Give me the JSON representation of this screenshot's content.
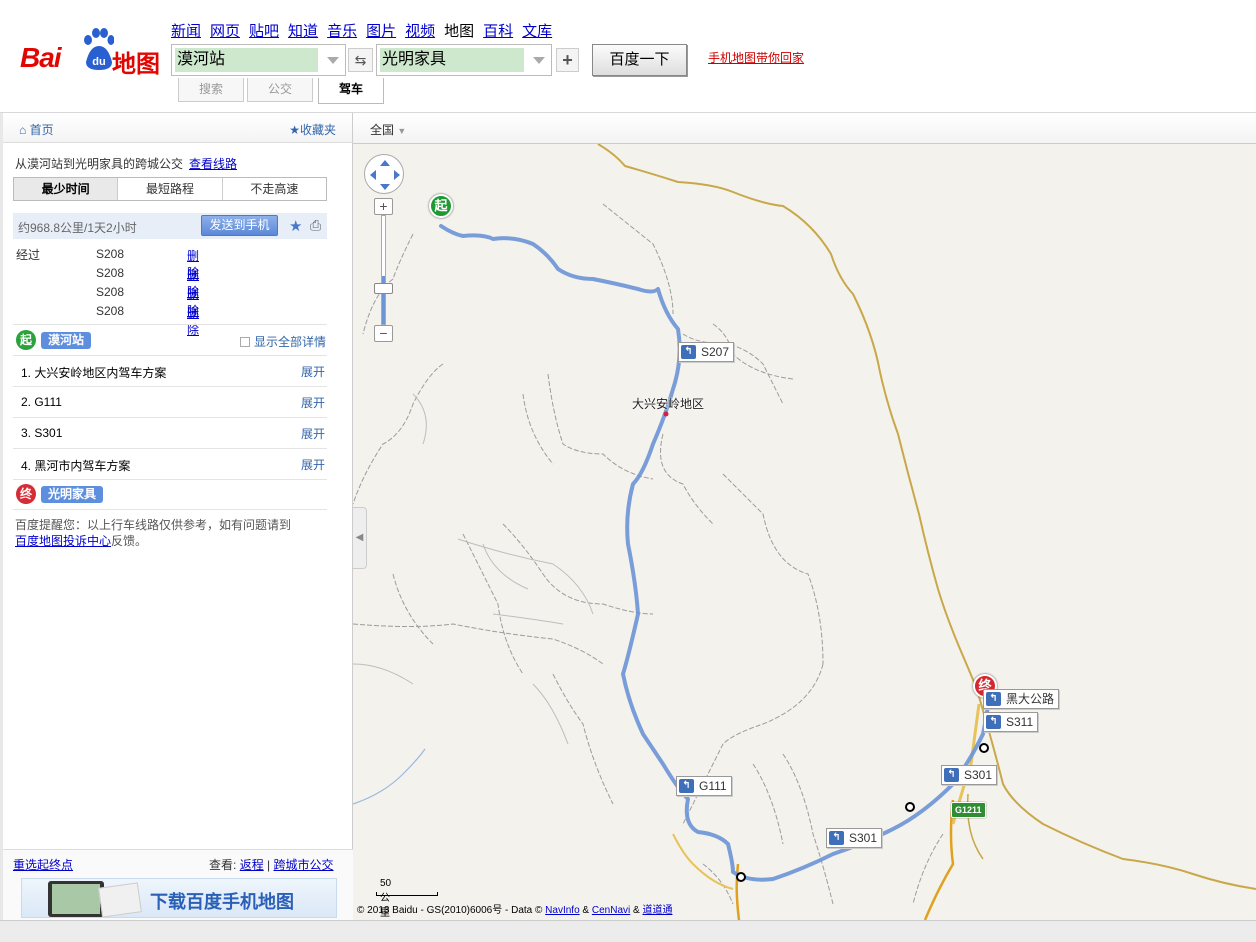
{
  "brand": {
    "logo_text_left": "Bai",
    "logo_text_mid": "du",
    "logo_text_right": "地图"
  },
  "nav": [
    "新闻",
    "网页",
    "贴吧",
    "知道",
    "音乐",
    "图片",
    "视频",
    "地图",
    "百科",
    "文库"
  ],
  "nav_current": "地图",
  "search": {
    "from_value": "漠河站",
    "to_value": "光明家具",
    "swap_icon": "swap-icon",
    "add_icon": "plus-icon",
    "go_label": "百度一下",
    "mobile_link": "手机地图带你回家"
  },
  "modes": {
    "search": "搜索",
    "bus": "公交",
    "drive": "驾车"
  },
  "left": {
    "home": "首页",
    "favorites": "收藏夹",
    "route_title": "从漠河站到光明家具的跨城公交",
    "view_route": "查看线路",
    "options": [
      "最少时间",
      "最短路程",
      "不走高速"
    ],
    "summary": "约968.8公里/1天2小时",
    "send_to_phone": "发送到手机",
    "via_label": "经过",
    "via": [
      {
        "road": "S208",
        "action": "删除"
      },
      {
        "road": "S208",
        "action": "删除"
      },
      {
        "road": "S208",
        "action": "删除"
      },
      {
        "road": "S208",
        "action": "删除"
      }
    ],
    "start_badge": "起",
    "start_name": "漠河站",
    "show_all": "显示全部详情",
    "steps": [
      {
        "text": "1. 大兴安岭地区内驾车方案",
        "action": "展开"
      },
      {
        "text": "2. G111",
        "action": "展开"
      },
      {
        "text": "3. S301",
        "action": "展开"
      },
      {
        "text": "4. 黑河市内驾车方案",
        "action": "展开"
      }
    ],
    "end_badge": "终",
    "end_name": "光明家具",
    "notice_text": "百度提醒您：以上行车线路仅供参考，如有问题请到",
    "notice_link": "百度地图投诉中心",
    "notice_tail": "反馈。",
    "reselect": "重选起终点",
    "view_label": "查看:",
    "view_return": "返程",
    "view_sep": "|",
    "view_bus": "跨城市公交",
    "banner": "下载百度手机地图"
  },
  "map": {
    "region": "全国",
    "place_label": "大兴安岭地区",
    "start_pin": "起",
    "end_pin": "终",
    "road_tags": [
      "S207",
      "G111",
      "S301",
      "S301",
      "S311",
      "黑大公路"
    ],
    "highway_shield": "G1211",
    "scale": "50 公里",
    "copyright_text": "© 2013 Baidu - GS(2010)6006号 - Data ©",
    "copyright_link1": "NavInfo",
    "copyright_amp1": "&",
    "copyright_link2": "CenNavi",
    "copyright_amp2": "&",
    "copyright_link3": "道道通"
  },
  "colors": {
    "route": "#6b93d6",
    "brand_red": "#e10602",
    "province_border": "#c8a84a"
  }
}
